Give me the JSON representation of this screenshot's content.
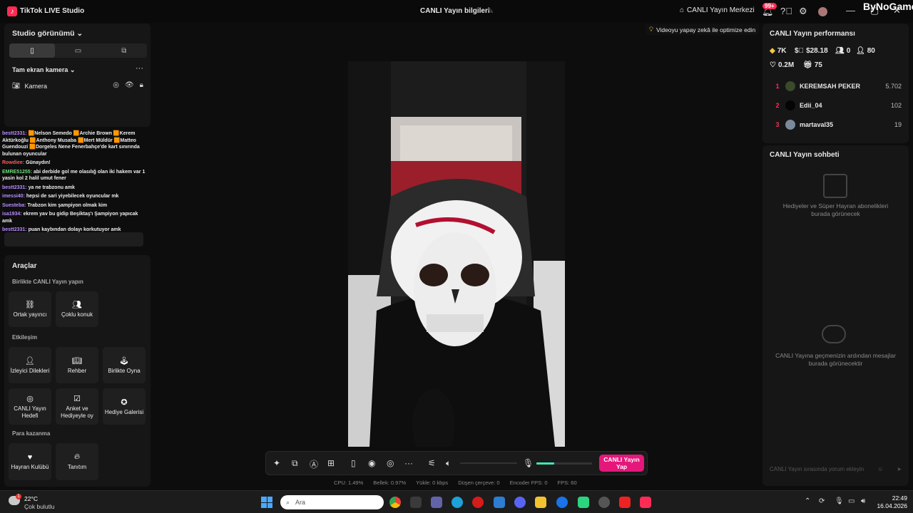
{
  "titlebar": {
    "app_title": "TikTok LIVE Studio",
    "center_title": "CANLI Yayın bilgileri",
    "live_center": "CANLI Yayın Merkezi",
    "notif_badge": "99+",
    "watermark": "ByNoGame"
  },
  "left_panel": {
    "studio_view": "Studio görünümü",
    "fullscreen_camera": "Tam ekran kamera",
    "camera_label": "Kamera"
  },
  "chat": {
    "messages": [
      {
        "name": "bestt2331:",
        "text": "🟧Nelson Semedo 🟧Archie Brown 🟧Kerem Aktürkoğlu 🟧Anthony Musaba 🟧Mert Müldür 🟧Matteo Guendouzi 🟧Dorgeles Nene Fenerbahçe'de kart sınırında bulunan oyuncular",
        "color": "purple"
      },
      {
        "name": "Rowdiee:",
        "text": "Günaydın!",
        "color": "red"
      },
      {
        "name": "EMRE51255:",
        "text": "abi derbide gol me olasılığ olan iki hakem var 1 yasin kol 2 halil umut fener",
        "color": "green"
      },
      {
        "name": "bestt2331:",
        "text": "ya ne trabzonu amk",
        "color": "purple"
      },
      {
        "name": "imessi40:",
        "text": "hepsi de sari yiyebilecek oyuncular mk",
        "color": "purple"
      },
      {
        "name": "Suesteba:",
        "text": "Trabzon kim şampiyon olmak kim",
        "color": "purple"
      },
      {
        "name": "isa1934:",
        "text": "ekrem yav bu gidip Beşiktaş'ı Şampiyon yapıcak amk",
        "color": "purple"
      },
      {
        "name": "bestt2331:",
        "text": "puan kaybından dolayı korkutuyor amk",
        "color": "purple"
      }
    ]
  },
  "tools": {
    "title": "Araçlar",
    "sec_together": "Birlikte CANLI Yayın yapın",
    "ortak": "Ortak yayıncı",
    "coklu": "Çoklu konuk",
    "sec_interaction": "Etkileşim",
    "izleyici": "İzleyici Dilekleri",
    "rehber": "Rehber",
    "birlikte_oyna": "Birlikte Oyna",
    "canli_hedef": "CANLI Yayın Hedefi",
    "anket": "Anket ve Hediyeyle oy",
    "hediye_galeri": "Hediye Galerisi",
    "sec_money": "Para kazanma",
    "hayran": "Hayran Kulübü",
    "tanitim": "Tanıtım"
  },
  "preview": {
    "ai_tip": "Videoyu yapay zekâ ile optimize edin"
  },
  "controls": {
    "go_live": "CANLI Yayın Yap",
    "mic_level": 0.32
  },
  "stats": {
    "cpu": "CPU:  1.49%",
    "memory": "Bellek:  0.97%",
    "upload": "Yükle:  0 kbps",
    "dropped": "Düşen çerçeve:  0",
    "encoder_fps": "Encoder FPS:  0",
    "fps": "FPS:  60"
  },
  "performance": {
    "title": "CANLI Yayın performansı",
    "diamonds": "7K",
    "earnings": "$28.18",
    "new_followers": "0",
    "viewers": "80",
    "likes": "0.2M",
    "gifts": "75",
    "leaderboard": [
      {
        "rank": "1",
        "name": "KEREMSAH PEKER",
        "score": "5.702"
      },
      {
        "rank": "2",
        "name": "Edii_04",
        "score": "102"
      },
      {
        "rank": "3",
        "name": "martaval35",
        "score": "19"
      }
    ]
  },
  "live_chat": {
    "title": "CANLI Yayın sohbeti",
    "gifts_msg": "Hediyeler ve Süper Hayran abonelikleri burada görünecek",
    "history_msg": "CANLI Yayına geçmenizin ardından mesajlar burada görünecektir",
    "input_placeholder": "CANLI Yayın sırasında yorum ekleyin"
  },
  "taskbar": {
    "temperature": "22°C",
    "condition": "Çok bulutlu",
    "weather_badge": "1",
    "search_placeholder": "Ara",
    "time": "22:49",
    "date": "16.04.2026"
  }
}
